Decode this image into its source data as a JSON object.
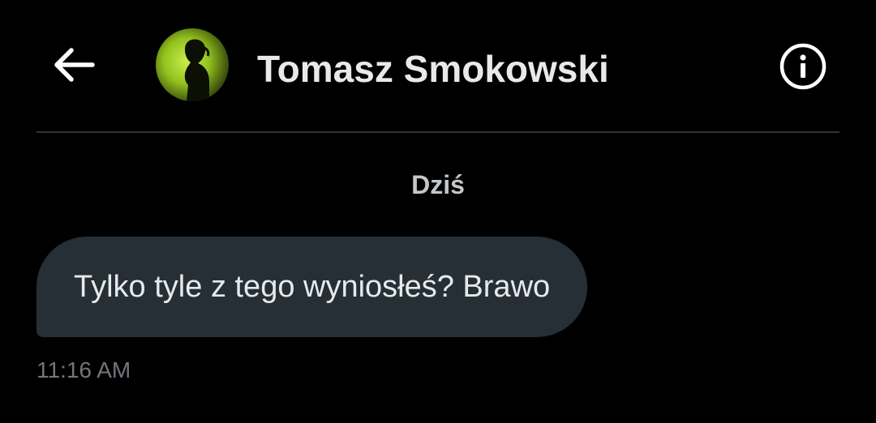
{
  "header": {
    "back_icon": "arrow-left-icon",
    "contact_name": "Tomasz Smokowski",
    "info_icon": "info-circle-icon",
    "avatar_accent": "#a6d42a"
  },
  "conversation": {
    "date_label": "Dziś",
    "messages": [
      {
        "text": "Tylko tyle z tego wyniosłeś? Brawo",
        "time": "11:16 AM",
        "direction": "incoming"
      }
    ]
  },
  "colors": {
    "background": "#000000",
    "bubble": "#262f36",
    "text_primary": "#e7e9ea",
    "text_secondary": "#71767b",
    "divider": "#2f3336"
  }
}
